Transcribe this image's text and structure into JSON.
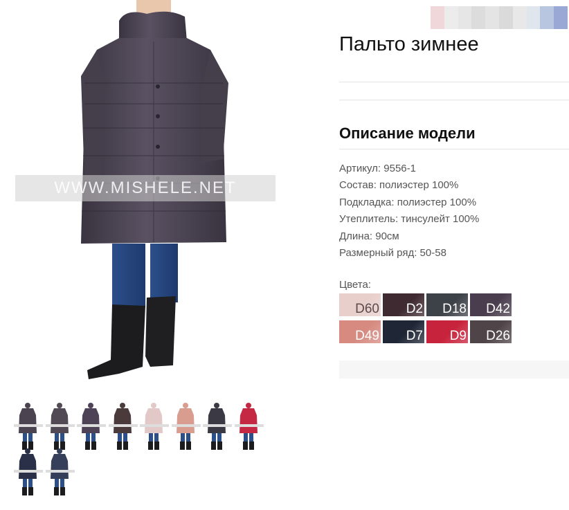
{
  "product": {
    "title": "Пальто зимнее",
    "description_heading": "Описание модели",
    "specs": [
      "Артикул: 9556-1",
      "Состав: полиэстер 100%",
      "Подкладка: полиэстер 100%",
      "Утеплитель: тинсулейт 100%",
      "Длина: 90см",
      "Размерный ряд: 50-58"
    ],
    "colors_label": "Цвета:",
    "colors": [
      {
        "code": "D60",
        "hex": "#e8cfcc"
      },
      {
        "code": "D2",
        "hex": "#3e2a30"
      },
      {
        "code": "D18",
        "hex": "#3d4148"
      },
      {
        "code": "D42",
        "hex": "#4a3d4e"
      },
      {
        "code": "D49",
        "hex": "#d68a80"
      },
      {
        "code": "D7",
        "hex": "#1f2636"
      },
      {
        "code": "D9",
        "hex": "#c8233c"
      },
      {
        "code": "D26",
        "hex": "#4f4448"
      }
    ]
  },
  "main_image": {
    "watermark": "WWW.MISHELE.NET",
    "coat_color": "#4b434f"
  },
  "thumbnails": [
    {
      "coat": "#4b434f"
    },
    {
      "coat": "#514a55"
    },
    {
      "coat": "#4d4256"
    },
    {
      "coat": "#4a3a3b"
    },
    {
      "coat": "#e2c8c6"
    },
    {
      "coat": "#d99d90"
    },
    {
      "coat": "#3b3a44"
    },
    {
      "coat": "#c42843"
    },
    {
      "coat": "#2a3048"
    },
    {
      "coat": "#363f5a"
    }
  ],
  "brand_logo_colors": [
    "#f0d7d9",
    "#ececec",
    "#e6e6e6",
    "#dcdcdc",
    "#e4e4e4",
    "#dadada",
    "#e8e8e8",
    "#e0e6ee",
    "#b8c6e0",
    "#9aa8d6"
  ]
}
